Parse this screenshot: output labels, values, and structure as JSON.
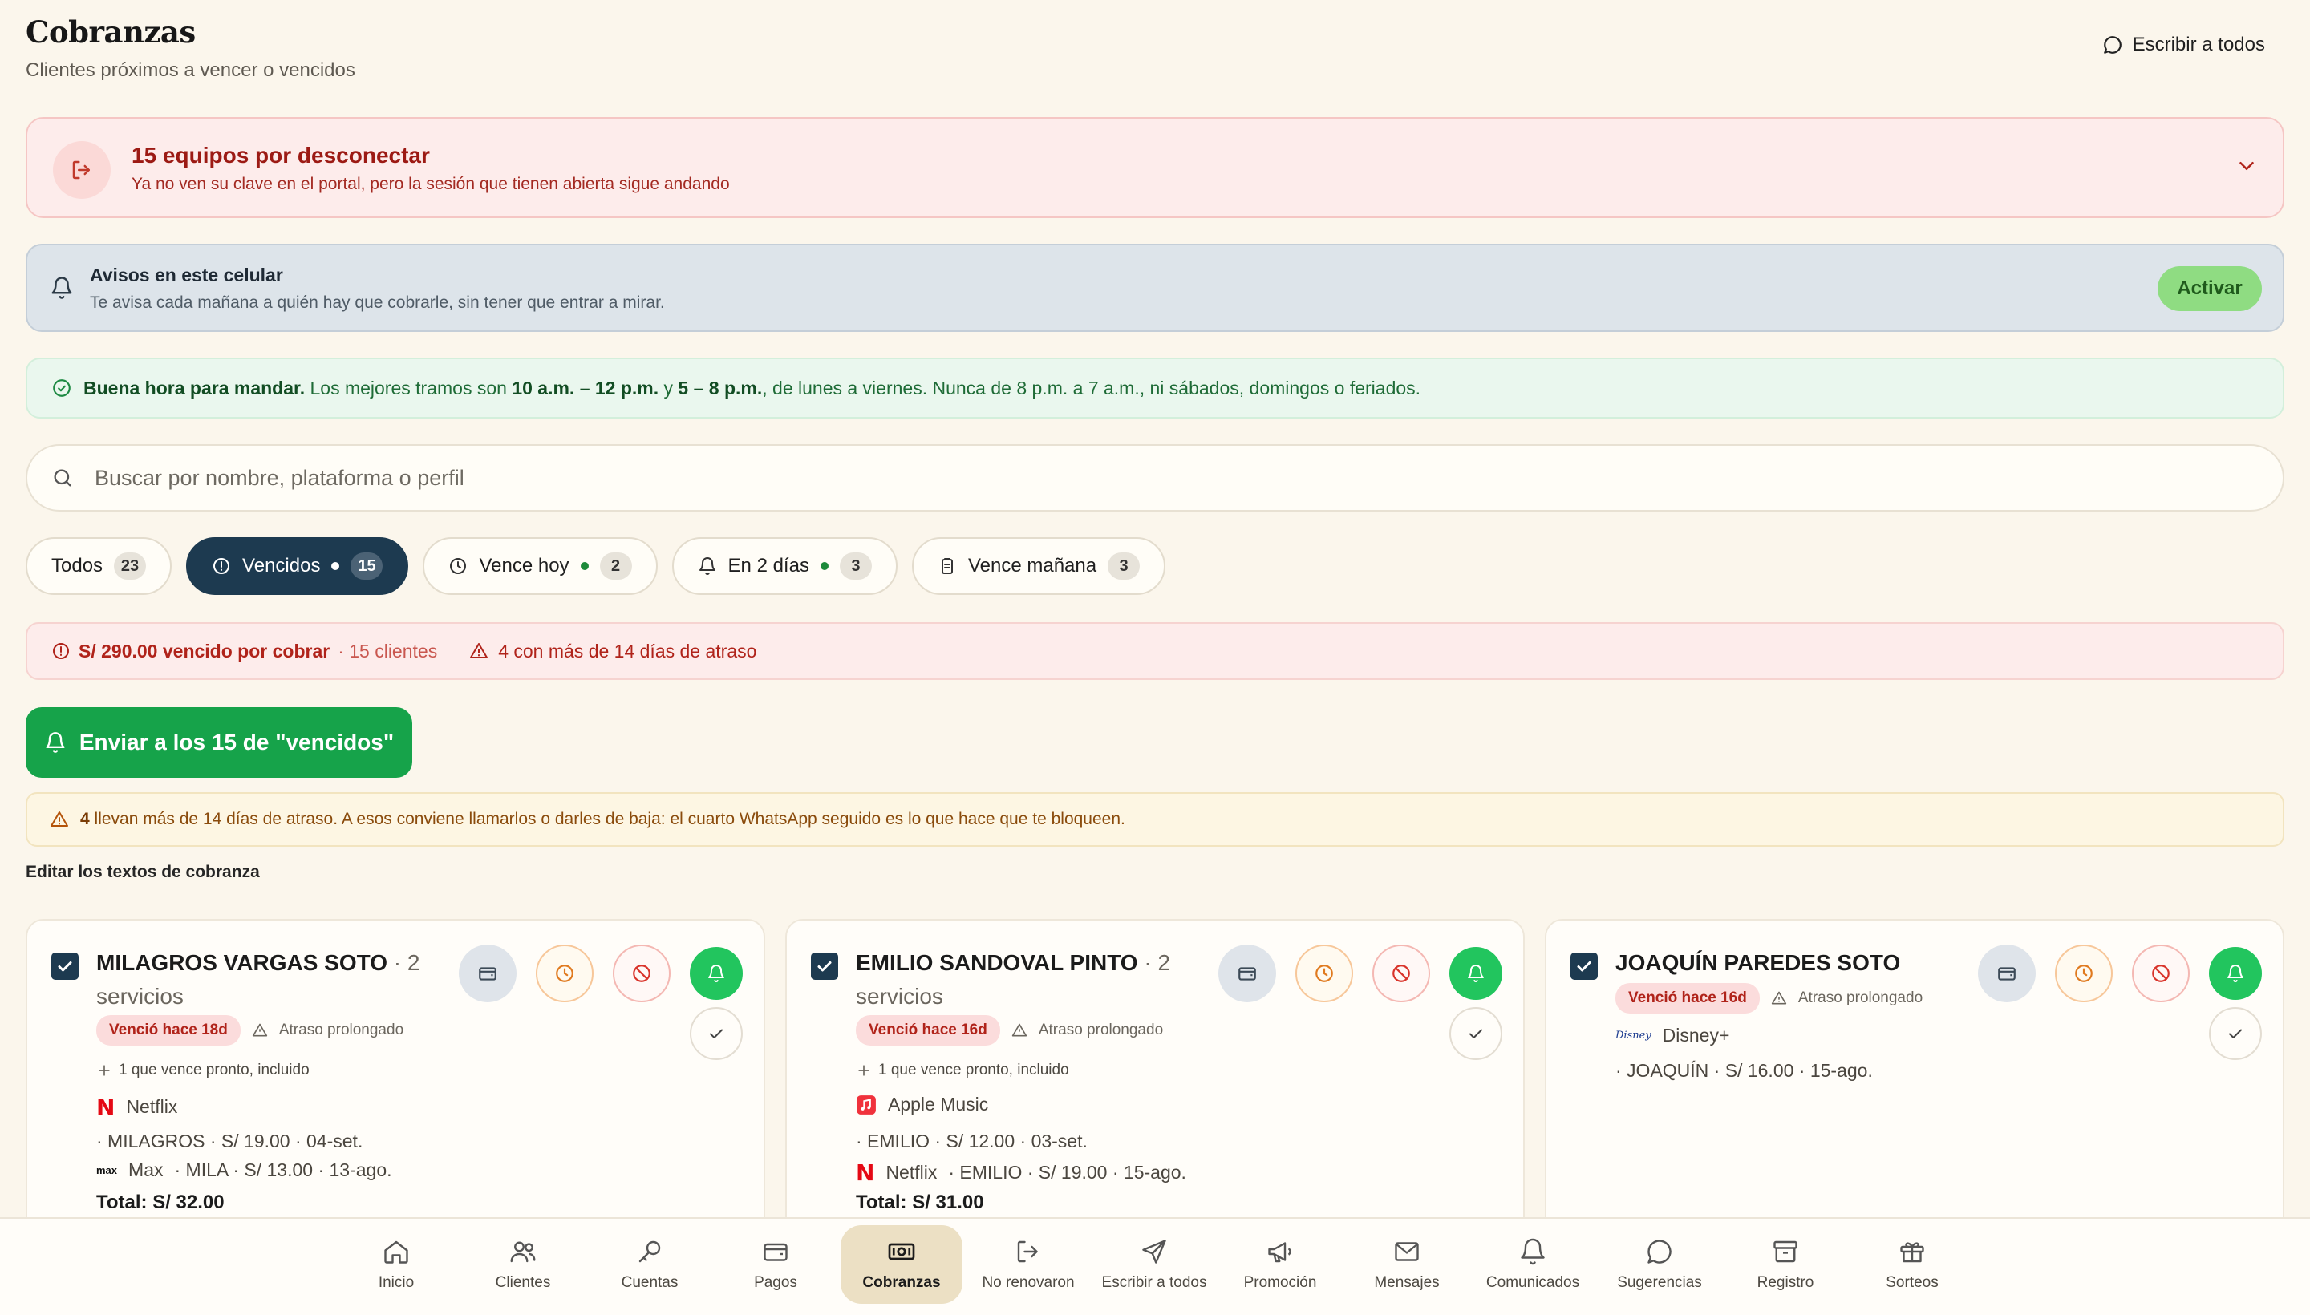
{
  "header": {
    "title": "Cobranzas",
    "subtitle": "Clientes próximos a vencer o vencidos",
    "write_all": "Escribir a todos"
  },
  "disconnect": {
    "title": "15 equipos por desconectar",
    "subtitle": "Ya no ven su clave en el portal, pero la sesión que tienen abierta sigue andando"
  },
  "avisos": {
    "title": "Avisos en este celular",
    "subtitle": "Te avisa cada mañana a quién hay que cobrarle, sin tener que entrar a mirar.",
    "button": "Activar"
  },
  "good_hour": {
    "lead": "Buena hora para mandar.",
    "t1": " Los mejores tramos son ",
    "range1": "10 a.m. – 12 p.m.",
    "t2": " y ",
    "range2": "5 – 8 p.m.",
    "t3": ", de lunes a viernes. Nunca de 8 p.m. a 7 a.m., ni sábados, domingos o feriados."
  },
  "search": {
    "placeholder": "Buscar por nombre, plataforma o perfil"
  },
  "filters": [
    {
      "label": "Todos",
      "count": "23"
    },
    {
      "label": "Vencidos",
      "count": "15"
    },
    {
      "label": "Vence hoy",
      "count": "2"
    },
    {
      "label": "En 2 días",
      "count": "3"
    },
    {
      "label": "Vence mañana",
      "count": "3"
    }
  ],
  "summary": {
    "amount": "S/ 290.00 vencido por cobrar",
    "clients": "· 15 clientes",
    "warning": "4 con más de 14 días de atraso"
  },
  "send_button": "Enviar a los 15 de \"vencidos\"",
  "warn_note": {
    "count": "4",
    "text": " llevan más de 14 días de atraso. A esos conviene llamarlos o darles de baja: el cuarto WhatsApp seguido es lo que hace que te bloqueen."
  },
  "edit_link": "Editar los textos de cobranza",
  "cards": [
    {
      "name": "MILAGROS VARGAS SOTO",
      "services": "· 2 servicios",
      "overdue": "Venció hace 18d",
      "delay": "Atraso prolongado",
      "extra": "1 que vence pronto, incluido",
      "svc1_name": "Netflix",
      "svc1_detail": "· MILAGROS · S/ 19.00 · 04-set.",
      "svc2_name": "Max",
      "svc2_detail": "· MILA · S/ 13.00 · 13-ago.",
      "total": "Total: S/ 32.00"
    },
    {
      "name": "EMILIO SANDOVAL PINTO",
      "services": "· 2 servicios",
      "overdue": "Venció hace 16d",
      "delay": "Atraso prolongado",
      "extra": "1 que vence pronto, incluido",
      "svc1_name": "Apple Music",
      "svc1_detail": "· EMILIO · S/ 12.00 · 03-set.",
      "svc2_name": "Netflix",
      "svc2_detail": "· EMILIO · S/ 19.00 · 15-ago.",
      "total": "Total: S/ 31.00"
    },
    {
      "name": "JOAQUÍN PAREDES SOTO",
      "overdue": "Venció hace 16d",
      "delay": "Atraso prolongado",
      "svc1_name": "Disney+",
      "svc1_detail": "· JOAQUÍN · S/ 16.00 · 15-ago."
    }
  ],
  "brand_icons": {
    "netflix": "N",
    "max": "max",
    "disney": "Disney"
  },
  "nav": [
    {
      "label": "Inicio",
      "icon": "home-icon"
    },
    {
      "label": "Clientes",
      "icon": "users-icon"
    },
    {
      "label": "Cuentas",
      "icon": "key-icon"
    },
    {
      "label": "Pagos",
      "icon": "wallet-icon"
    },
    {
      "label": "Cobranzas",
      "icon": "banknote-icon"
    },
    {
      "label": "No renovaron",
      "icon": "logout-icon"
    },
    {
      "label": "Escribir a todos",
      "icon": "send-icon"
    },
    {
      "label": "Promoción",
      "icon": "megaphone-icon"
    },
    {
      "label": "Mensajes",
      "icon": "mail-icon"
    },
    {
      "label": "Comunicados",
      "icon": "bell-icon"
    },
    {
      "label": "Sugerencias",
      "icon": "chat-icon"
    },
    {
      "label": "Registro",
      "icon": "archive-icon"
    },
    {
      "label": "Sorteos",
      "icon": "gift-icon"
    }
  ],
  "colors": {
    "background": "#fbf6ec",
    "accent_navy": "#1d3a50",
    "success_green": "#16a34a",
    "danger_red": "#b0231a"
  }
}
